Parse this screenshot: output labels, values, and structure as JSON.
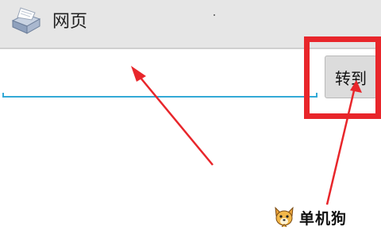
{
  "titlebar": {
    "title": "网页",
    "icon": "browser-app-icon"
  },
  "address_bar": {
    "value": "",
    "placeholder": ""
  },
  "go_button": {
    "label": "转到"
  },
  "annotation": {
    "highlight_color": "#e8262b",
    "arrow_color": "#e8262b",
    "underline_color": "#33a9d6"
  },
  "watermark": {
    "text": "单机狗",
    "icon": "dog-mascot-icon"
  }
}
